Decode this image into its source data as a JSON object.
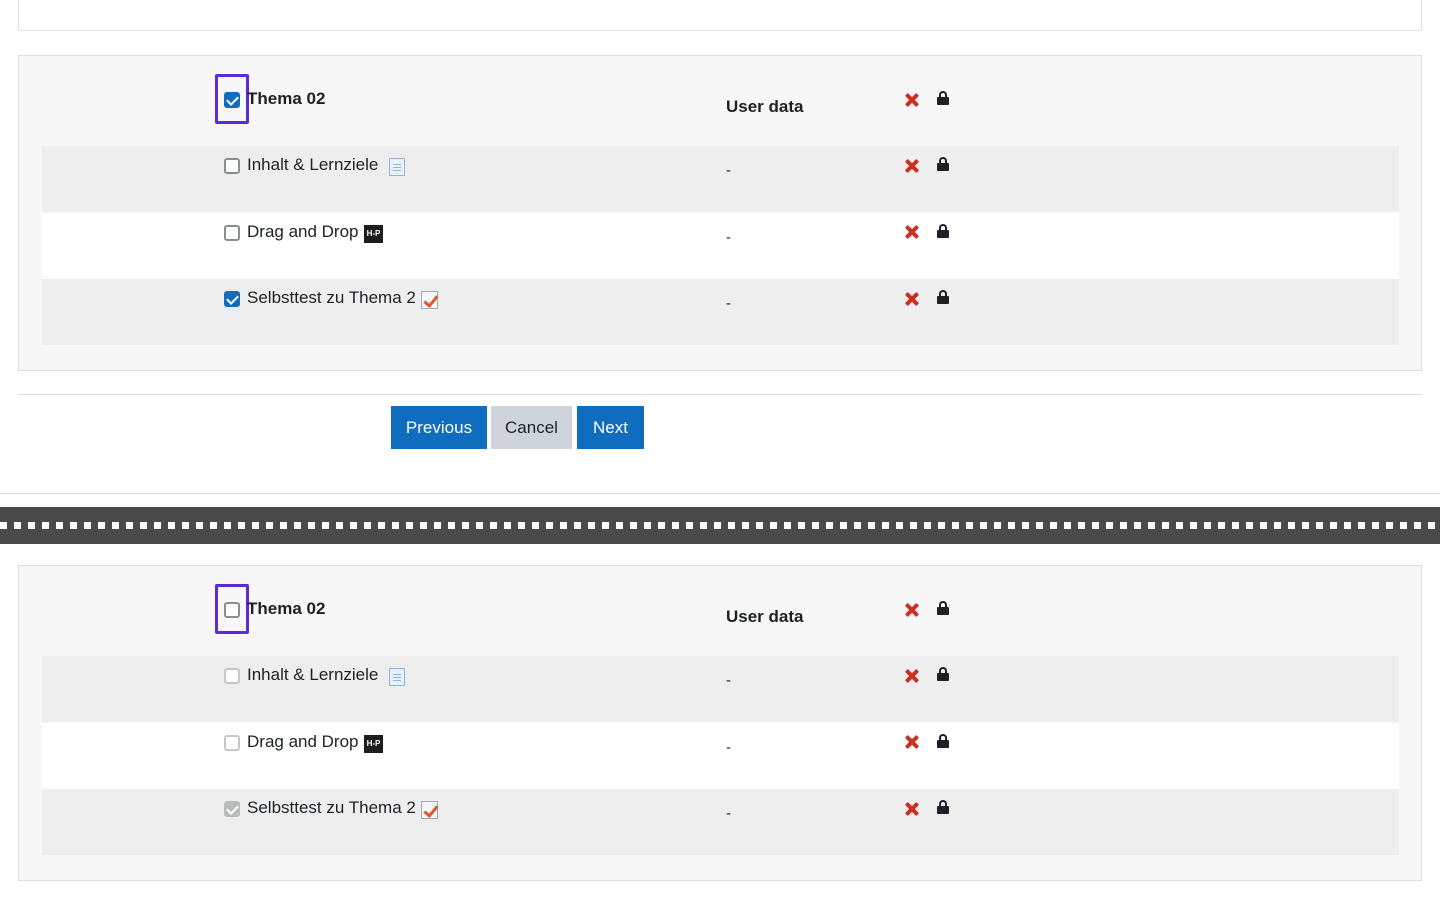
{
  "panels": [
    {
      "section": {
        "title": "Thema 02",
        "checked": true,
        "user_data_header": "User data"
      },
      "items": [
        {
          "label": "Inhalt & Lernziele",
          "checked": false,
          "icon": "page-icon",
          "user_data": "-"
        },
        {
          "label": "Drag and Drop",
          "checked": false,
          "icon": "h5p-icon",
          "user_data": "-"
        },
        {
          "label": "Selbsttest zu Thema 2",
          "checked": true,
          "icon": "quiz-icon",
          "user_data": "-"
        }
      ]
    },
    {
      "section": {
        "title": "Thema 02",
        "checked": false,
        "user_data_header": "User data"
      },
      "items": [
        {
          "label": "Inhalt & Lernziele",
          "checked": false,
          "disabled": true,
          "icon": "page-icon",
          "user_data": "-"
        },
        {
          "label": "Drag and Drop",
          "checked": false,
          "disabled": true,
          "icon": "h5p-icon",
          "user_data": "-"
        },
        {
          "label": "Selbsttest zu Thema 2",
          "checked": true,
          "disabled": true,
          "icon": "quiz-icon",
          "user_data": "-"
        }
      ]
    }
  ],
  "buttons": {
    "previous": "Previous",
    "cancel": "Cancel",
    "next": "Next"
  },
  "icons": {
    "h5p_text": "H-P"
  },
  "colors": {
    "primary": "#0f6cbf",
    "secondary": "#ced4da",
    "focus": "#5a2bd8",
    "delete": "#ca3120"
  }
}
